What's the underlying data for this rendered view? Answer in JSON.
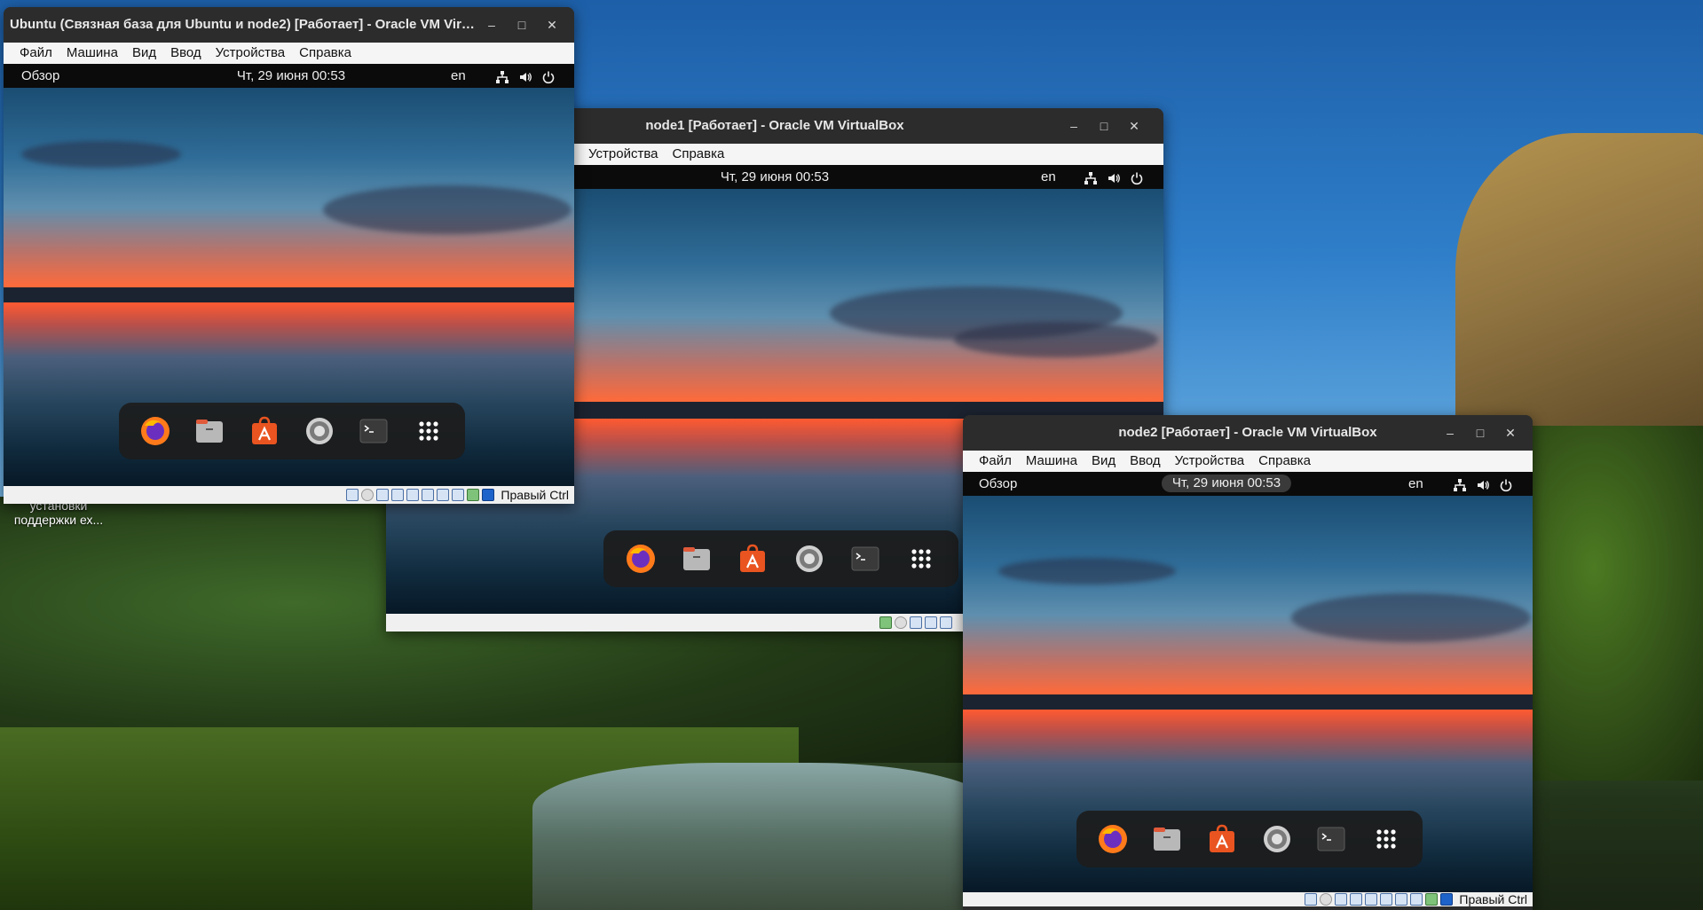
{
  "desktop": {
    "icon_label_line1": "установки",
    "icon_label_line2": "поддержки ех..."
  },
  "windows": {
    "ubuntu": {
      "title": "Ubuntu (Связная база для Ubuntu и node2) [Работает] - Oracle VM Virt...",
      "menu": [
        "Файл",
        "Машина",
        "Вид",
        "Ввод",
        "Устройства",
        "Справка"
      ],
      "guest": {
        "activities": "Обзор",
        "clock": "Чт, 29 июня  00:53",
        "lang": "en"
      },
      "host_key": "Правый Ctrl"
    },
    "node1": {
      "title": "node1 [Работает] - Oracle VM VirtualBox",
      "menu": [
        "Устройства",
        "Справка"
      ],
      "guest": {
        "clock": "Чт, 29 июня  00:53",
        "lang": "en"
      }
    },
    "node2": {
      "title": "node2 [Работает] - Oracle VM VirtualBox",
      "menu": [
        "Файл",
        "Машина",
        "Вид",
        "Ввод",
        "Устройства",
        "Справка"
      ],
      "guest": {
        "activities": "Обзор",
        "clock": "Чт, 29 июня  00:53",
        "lang": "en"
      },
      "host_key": "Правый Ctrl"
    }
  },
  "window_controls": {
    "minimize": "–",
    "maximize": "□",
    "close": "✕"
  },
  "dock_apps": [
    "firefox-icon",
    "files-icon",
    "app-center-icon",
    "settings-icon",
    "terminal-icon",
    "show-apps-icon"
  ],
  "colors": {
    "titlebar": "#2c2c2c",
    "menubar": "#f5f5f5",
    "guest_topbar": "#0b0b0b",
    "dock": "#1c1c1c",
    "ubuntu_orange": "#e95420"
  }
}
